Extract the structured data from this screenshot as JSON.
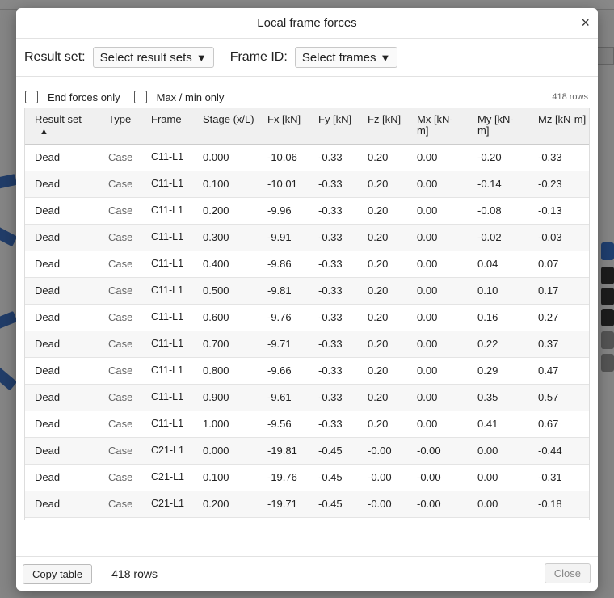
{
  "dialog": {
    "title": "Local frame forces",
    "close_icon": "close-icon"
  },
  "filters": {
    "result_set_label": "Result set:",
    "result_set_select": "Select result sets",
    "frame_id_label": "Frame ID:",
    "frame_id_select": "Select frames",
    "caret": "▼"
  },
  "options": {
    "end_forces_only": "End forces only",
    "max_min_only": "Max / min only",
    "row_count": "418 rows"
  },
  "table": {
    "headers": {
      "result_set": "Result set",
      "sort_indicator": "▲",
      "type": "Type",
      "frame": "Frame",
      "stage": "Stage (x/L)",
      "fx": "Fx [kN]",
      "fy": "Fy [kN]",
      "fz": "Fz [kN]",
      "mx": "Mx [kN-m]",
      "my": "My [kN-m]",
      "mz": "Mz [kN-m]"
    },
    "rows": [
      [
        "Dead",
        "Case",
        "C11-L1",
        "0.000",
        "-10.06",
        "-0.33",
        "0.20",
        "0.00",
        "-0.20",
        "-0.33"
      ],
      [
        "Dead",
        "Case",
        "C11-L1",
        "0.100",
        "-10.01",
        "-0.33",
        "0.20",
        "0.00",
        "-0.14",
        "-0.23"
      ],
      [
        "Dead",
        "Case",
        "C11-L1",
        "0.200",
        "-9.96",
        "-0.33",
        "0.20",
        "0.00",
        "-0.08",
        "-0.13"
      ],
      [
        "Dead",
        "Case",
        "C11-L1",
        "0.300",
        "-9.91",
        "-0.33",
        "0.20",
        "0.00",
        "-0.02",
        "-0.03"
      ],
      [
        "Dead",
        "Case",
        "C11-L1",
        "0.400",
        "-9.86",
        "-0.33",
        "0.20",
        "0.00",
        "0.04",
        "0.07"
      ],
      [
        "Dead",
        "Case",
        "C11-L1",
        "0.500",
        "-9.81",
        "-0.33",
        "0.20",
        "0.00",
        "0.10",
        "0.17"
      ],
      [
        "Dead",
        "Case",
        "C11-L1",
        "0.600",
        "-9.76",
        "-0.33",
        "0.20",
        "0.00",
        "0.16",
        "0.27"
      ],
      [
        "Dead",
        "Case",
        "C11-L1",
        "0.700",
        "-9.71",
        "-0.33",
        "0.20",
        "0.00",
        "0.22",
        "0.37"
      ],
      [
        "Dead",
        "Case",
        "C11-L1",
        "0.800",
        "-9.66",
        "-0.33",
        "0.20",
        "0.00",
        "0.29",
        "0.47"
      ],
      [
        "Dead",
        "Case",
        "C11-L1",
        "0.900",
        "-9.61",
        "-0.33",
        "0.20",
        "0.00",
        "0.35",
        "0.57"
      ],
      [
        "Dead",
        "Case",
        "C11-L1",
        "1.000",
        "-9.56",
        "-0.33",
        "0.20",
        "0.00",
        "0.41",
        "0.67"
      ],
      [
        "Dead",
        "Case",
        "C21-L1",
        "0.000",
        "-19.81",
        "-0.45",
        "-0.00",
        "-0.00",
        "0.00",
        "-0.44"
      ],
      [
        "Dead",
        "Case",
        "C21-L1",
        "0.100",
        "-19.76",
        "-0.45",
        "-0.00",
        "-0.00",
        "0.00",
        "-0.31"
      ],
      [
        "Dead",
        "Case",
        "C21-L1",
        "0.200",
        "-19.71",
        "-0.45",
        "-0.00",
        "-0.00",
        "0.00",
        "-0.18"
      ]
    ]
  },
  "footer": {
    "copy_button": "Copy table",
    "row_count": "418 rows",
    "close_button": "Close"
  }
}
